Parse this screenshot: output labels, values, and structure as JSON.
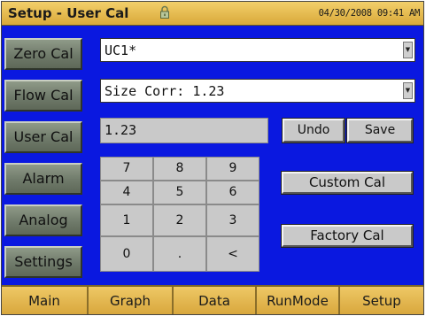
{
  "title": "Setup - User Cal",
  "datetime": "04/30/2008 09:41 AM",
  "sidebar": {
    "items": [
      {
        "label": "Zero Cal"
      },
      {
        "label": "Flow Cal"
      },
      {
        "label": "User Cal"
      },
      {
        "label": "Alarm"
      },
      {
        "label": "Analog"
      },
      {
        "label": "Settings"
      }
    ]
  },
  "main": {
    "cal_select": {
      "value": "UC1*"
    },
    "param_select": {
      "value": "Size Corr: 1.23"
    },
    "entry_value": "1.23",
    "undo_label": "Undo",
    "save_label": "Save",
    "custom_cal_label": "Custom Cal",
    "factory_cal_label": "Factory Cal",
    "keypad": [
      [
        "7",
        "8",
        "9"
      ],
      [
        "4",
        "5",
        "6"
      ],
      [
        "1",
        "2",
        "3"
      ],
      [
        "0",
        ".",
        "<"
      ]
    ]
  },
  "tabs": [
    {
      "label": "Main"
    },
    {
      "label": "Graph"
    },
    {
      "label": "Data"
    },
    {
      "label": "RunMode"
    },
    {
      "label": "Setup"
    }
  ],
  "colors": {
    "background": "#0a18e0",
    "title_bar": "#e2b84e",
    "nav_button": "#7c8776",
    "control_gray": "#c9c9c9"
  },
  "icons": {
    "title_icon": "lock-icon"
  }
}
